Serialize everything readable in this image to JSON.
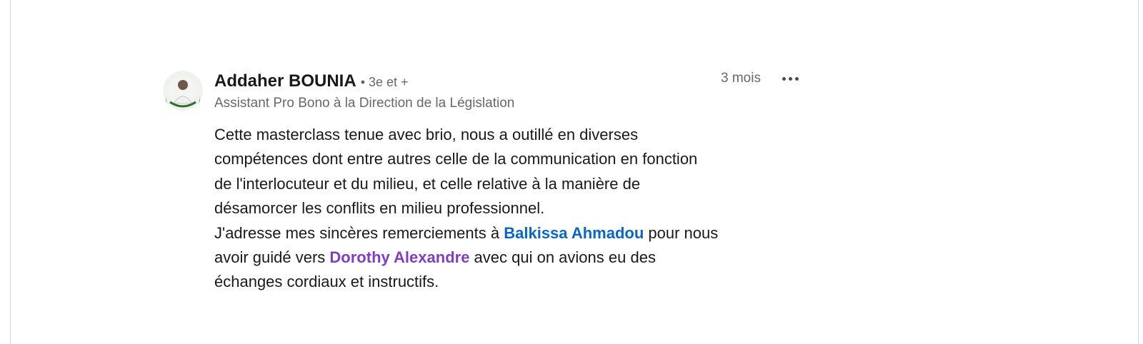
{
  "comment": {
    "author": {
      "name": "Addaher BOUNIA",
      "degree": "• 3e et +",
      "headline": "Assistant Pro Bono à la Direction de la Législation"
    },
    "time": "3 mois",
    "more_icon": "ellipsis-horizontal-icon",
    "text": {
      "lines": [
        "Cette masterclass tenue avec brio, nous a outillé en diverses",
        "compétences dont entre autres celle de la communication en fonction",
        "de l'interlocuteur et du milieu, et celle relative à la manière de",
        "désamorcer les conflits en milieu professionnel."
      ],
      "line5_prefix": "J'adresse mes sincères remerciements à ",
      "line5_suffix": " pour nous",
      "line6_prefix": "avoir guidé vers ",
      "line6_suffix": " avec qui on avions eu des",
      "line7": "échanges cordiaux et instructifs."
    },
    "mentions": [
      {
        "name": "Balkissa Ahmadou",
        "color": "#0a66c2"
      },
      {
        "name": "Dorothy Alexandre",
        "color": "#7f3fbf"
      }
    ]
  }
}
